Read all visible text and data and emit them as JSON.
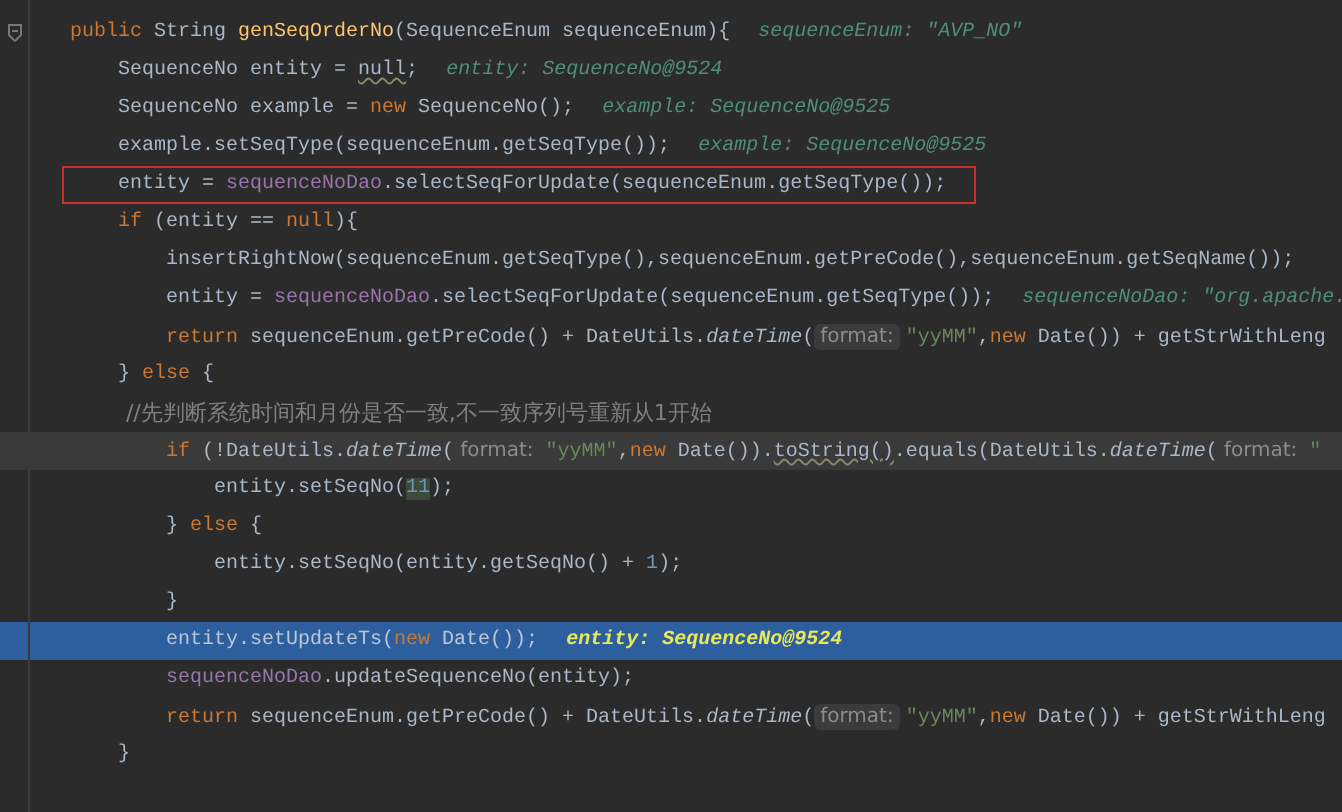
{
  "editor": {
    "lines": [
      {
        "fold_marker": true,
        "highlighted": false,
        "caret_line": false,
        "annotated": false,
        "tokens": [
          {
            "kind": "kw",
            "text": "public "
          },
          {
            "kind": "plain",
            "text": "String "
          },
          {
            "kind": "fn",
            "text": "genSeqOrderNo"
          },
          {
            "kind": "plain",
            "text": "(SequenceEnum sequenceEnum){"
          }
        ],
        "hint": "sequenceEnum: \"AVP_NO\""
      },
      {
        "fold_marker": false,
        "highlighted": false,
        "caret_line": false,
        "annotated": false,
        "tokens": [
          {
            "kind": "plain",
            "text": "    SequenceNo entity = "
          },
          {
            "kind": "warn",
            "text": "null"
          },
          {
            "kind": "plain",
            "text": ";"
          }
        ],
        "hint": "entity: SequenceNo@9524"
      },
      {
        "fold_marker": false,
        "highlighted": false,
        "caret_line": false,
        "annotated": false,
        "tokens": [
          {
            "kind": "plain",
            "text": "    SequenceNo example = "
          },
          {
            "kind": "kw",
            "text": "new "
          },
          {
            "kind": "plain",
            "text": "SequenceNo();"
          }
        ],
        "hint": "example: SequenceNo@9525"
      },
      {
        "fold_marker": false,
        "highlighted": false,
        "caret_line": false,
        "annotated": false,
        "tokens": [
          {
            "kind": "plain",
            "text": "    example.setSeqType(sequenceEnum.getSeqType());"
          }
        ],
        "hint": "example: SequenceNo@9525"
      },
      {
        "fold_marker": false,
        "highlighted": false,
        "caret_line": false,
        "annotated": true,
        "tokens": [
          {
            "kind": "plain",
            "text": "    entity = "
          },
          {
            "kind": "field",
            "text": "sequenceNoDao"
          },
          {
            "kind": "plain",
            "text": ".selectSeqForUpdate(sequenceEnum.getSeqType());"
          }
        ]
      },
      {
        "fold_marker": false,
        "highlighted": false,
        "caret_line": false,
        "annotated": false,
        "tokens": [
          {
            "kind": "kw",
            "text": "    if "
          },
          {
            "kind": "plain",
            "text": "(entity == "
          },
          {
            "kind": "kw",
            "text": "null"
          },
          {
            "kind": "plain",
            "text": "){"
          }
        ]
      },
      {
        "fold_marker": false,
        "highlighted": false,
        "caret_line": false,
        "annotated": false,
        "tokens": [
          {
            "kind": "plain",
            "text": "        insertRightNow(sequenceEnum.getSeqType(),sequenceEnum.getPreCode(),sequenceEnum.getSeqName());"
          }
        ]
      },
      {
        "fold_marker": false,
        "highlighted": false,
        "caret_line": false,
        "annotated": false,
        "tokens": [
          {
            "kind": "plain",
            "text": "        entity = "
          },
          {
            "kind": "field",
            "text": "sequenceNoDao"
          },
          {
            "kind": "plain",
            "text": ".selectSeqForUpdate(sequenceEnum.getSeqType());"
          }
        ],
        "hint": "sequenceNoDao: \"org.apache."
      },
      {
        "fold_marker": false,
        "highlighted": false,
        "caret_line": false,
        "annotated": false,
        "tokens": [
          {
            "kind": "kw",
            "text": "        return "
          },
          {
            "kind": "plain",
            "text": "sequenceEnum.getPreCode() + DateUtils."
          },
          {
            "kind": "static",
            "text": "dateTime"
          },
          {
            "kind": "plain",
            "text": "("
          },
          {
            "kind": "param",
            "text": "format:"
          },
          {
            "kind": "str",
            "text": "\"yyMM\""
          },
          {
            "kind": "plain",
            "text": ","
          },
          {
            "kind": "kw",
            "text": "new "
          },
          {
            "kind": "plain",
            "text": "Date()) + getStrWithLeng"
          }
        ]
      },
      {
        "fold_marker": false,
        "highlighted": false,
        "caret_line": false,
        "annotated": false,
        "tokens": [
          {
            "kind": "plain",
            "text": "    } "
          },
          {
            "kind": "kw",
            "text": "else "
          },
          {
            "kind": "plain",
            "text": "{"
          }
        ]
      },
      {
        "fold_marker": false,
        "highlighted": false,
        "caret_line": false,
        "annotated": false,
        "tokens": [
          {
            "kind": "comment",
            "text": "        //先判断系统时间和月份是否一致,不一致序列号重新从1开始"
          }
        ]
      },
      {
        "fold_marker": false,
        "highlighted": false,
        "caret_line": true,
        "annotated": false,
        "tokens": [
          {
            "kind": "kw",
            "text": "        if "
          },
          {
            "kind": "plain",
            "text": "(!DateUtils."
          },
          {
            "kind": "static",
            "text": "dateTime"
          },
          {
            "kind": "plain",
            "text": "("
          },
          {
            "kind": "param",
            "text": "format:"
          },
          {
            "kind": "str",
            "text": "\"yyMM\""
          },
          {
            "kind": "plain",
            "text": ","
          },
          {
            "kind": "kw",
            "text": "new "
          },
          {
            "kind": "plain",
            "text": "Date())."
          },
          {
            "kind": "warn",
            "text": "toString()"
          },
          {
            "kind": "plain",
            "text": ".equals(DateUtils."
          },
          {
            "kind": "static",
            "text": "dateTime"
          },
          {
            "kind": "plain",
            "text": "("
          },
          {
            "kind": "param",
            "text": "format:"
          },
          {
            "kind": "str",
            "text": "\""
          }
        ]
      },
      {
        "fold_marker": false,
        "highlighted": false,
        "caret_line": false,
        "annotated": false,
        "tokens": [
          {
            "kind": "plain",
            "text": "            entity.setSeqNo("
          },
          {
            "kind": "numhl",
            "text": "11"
          },
          {
            "kind": "plain",
            "text": ");"
          }
        ]
      },
      {
        "fold_marker": false,
        "highlighted": false,
        "caret_line": false,
        "annotated": false,
        "tokens": [
          {
            "kind": "plain",
            "text": "        } "
          },
          {
            "kind": "kw",
            "text": "else "
          },
          {
            "kind": "plain",
            "text": "{"
          }
        ]
      },
      {
        "fold_marker": false,
        "highlighted": false,
        "caret_line": false,
        "annotated": false,
        "tokens": [
          {
            "kind": "plain",
            "text": "            entity.setSeqNo(entity.getSeqNo() + "
          },
          {
            "kind": "num",
            "text": "1"
          },
          {
            "kind": "plain",
            "text": ");"
          }
        ]
      },
      {
        "fold_marker": false,
        "highlighted": false,
        "caret_line": false,
        "annotated": false,
        "tokens": [
          {
            "kind": "plain",
            "text": "        }"
          }
        ]
      },
      {
        "fold_marker": false,
        "highlighted": true,
        "caret_line": false,
        "annotated": false,
        "tokens": [
          {
            "kind": "plain",
            "text": "        entity.setUpdateTs("
          },
          {
            "kind": "kw",
            "text": "new "
          },
          {
            "kind": "plain",
            "text": "Date());"
          }
        ],
        "hint": "entity: SequenceNo@9524"
      },
      {
        "fold_marker": false,
        "highlighted": false,
        "caret_line": false,
        "annotated": false,
        "tokens": [
          {
            "kind": "field",
            "text": "        sequenceNoDao"
          },
          {
            "kind": "plain",
            "text": ".updateSequenceNo(entity);"
          }
        ]
      },
      {
        "fold_marker": false,
        "highlighted": false,
        "caret_line": false,
        "annotated": false,
        "tokens": [
          {
            "kind": "kw",
            "text": "        return "
          },
          {
            "kind": "plain",
            "text": "sequenceEnum.getPreCode() + DateUtils."
          },
          {
            "kind": "static",
            "text": "dateTime"
          },
          {
            "kind": "plain",
            "text": "("
          },
          {
            "kind": "param",
            "text": "format:"
          },
          {
            "kind": "str",
            "text": "\"yyMM\""
          },
          {
            "kind": "plain",
            "text": ","
          },
          {
            "kind": "kw",
            "text": "new "
          },
          {
            "kind": "plain",
            "text": "Date()) + getStrWithLeng"
          }
        ]
      },
      {
        "fold_marker": false,
        "highlighted": false,
        "caret_line": false,
        "annotated": false,
        "tokens": [
          {
            "kind": "plain",
            "text": "    }"
          }
        ]
      }
    ]
  }
}
